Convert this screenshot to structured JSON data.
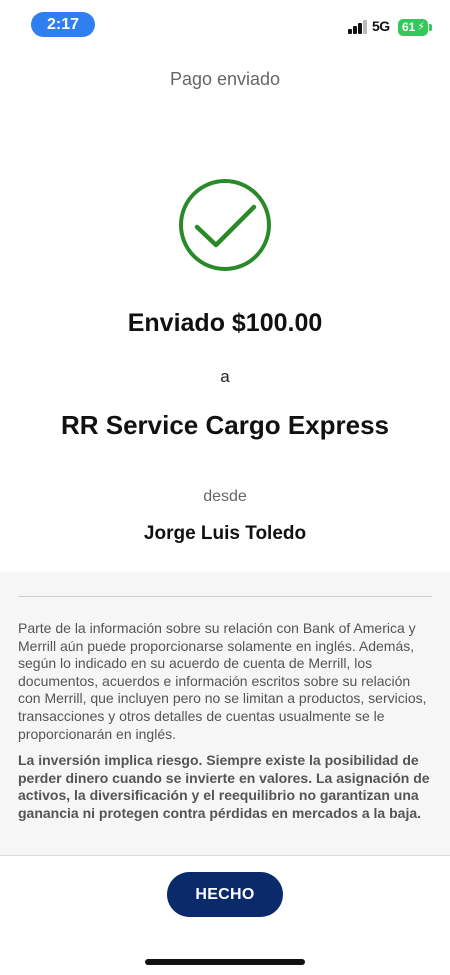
{
  "status_bar": {
    "time": "2:17",
    "network": "5G",
    "battery": "61"
  },
  "header": {
    "title": "Pago enviado"
  },
  "icons": {
    "success": "check-circle-icon",
    "success_color": "#2a8a2a"
  },
  "confirmation": {
    "amount_text": "Enviado $100.00",
    "to_word": "a",
    "recipient": "RR Service Cargo Express",
    "from_word": "desde",
    "sender": "Jorge Luis Toledo"
  },
  "disclosure": {
    "info_text": "Parte de la información sobre su relación con Bank of America y Merrill aún puede proporcionarse solamente en inglés. Además, según lo indicado en su acuerdo de cuenta de Merrill, los documentos, acuerdos e información escritos sobre su relación con Merrill, que incluyen pero no se limitan a productos, servicios, transacciones y otros detalles de cuentas usualmente se le proporcionarán en inglés.",
    "risk_text": "La inversión implica riesgo. Siempre existe la posibilidad de perder dinero cuando se invierte en valores. La asignación de activos, la diversificación y el reequilibrio no garantizan una ganancia ni protegen contra pérdidas en mercados a la baja."
  },
  "actions": {
    "done_label": "HECHO",
    "done_color": "#0b2a6b"
  }
}
